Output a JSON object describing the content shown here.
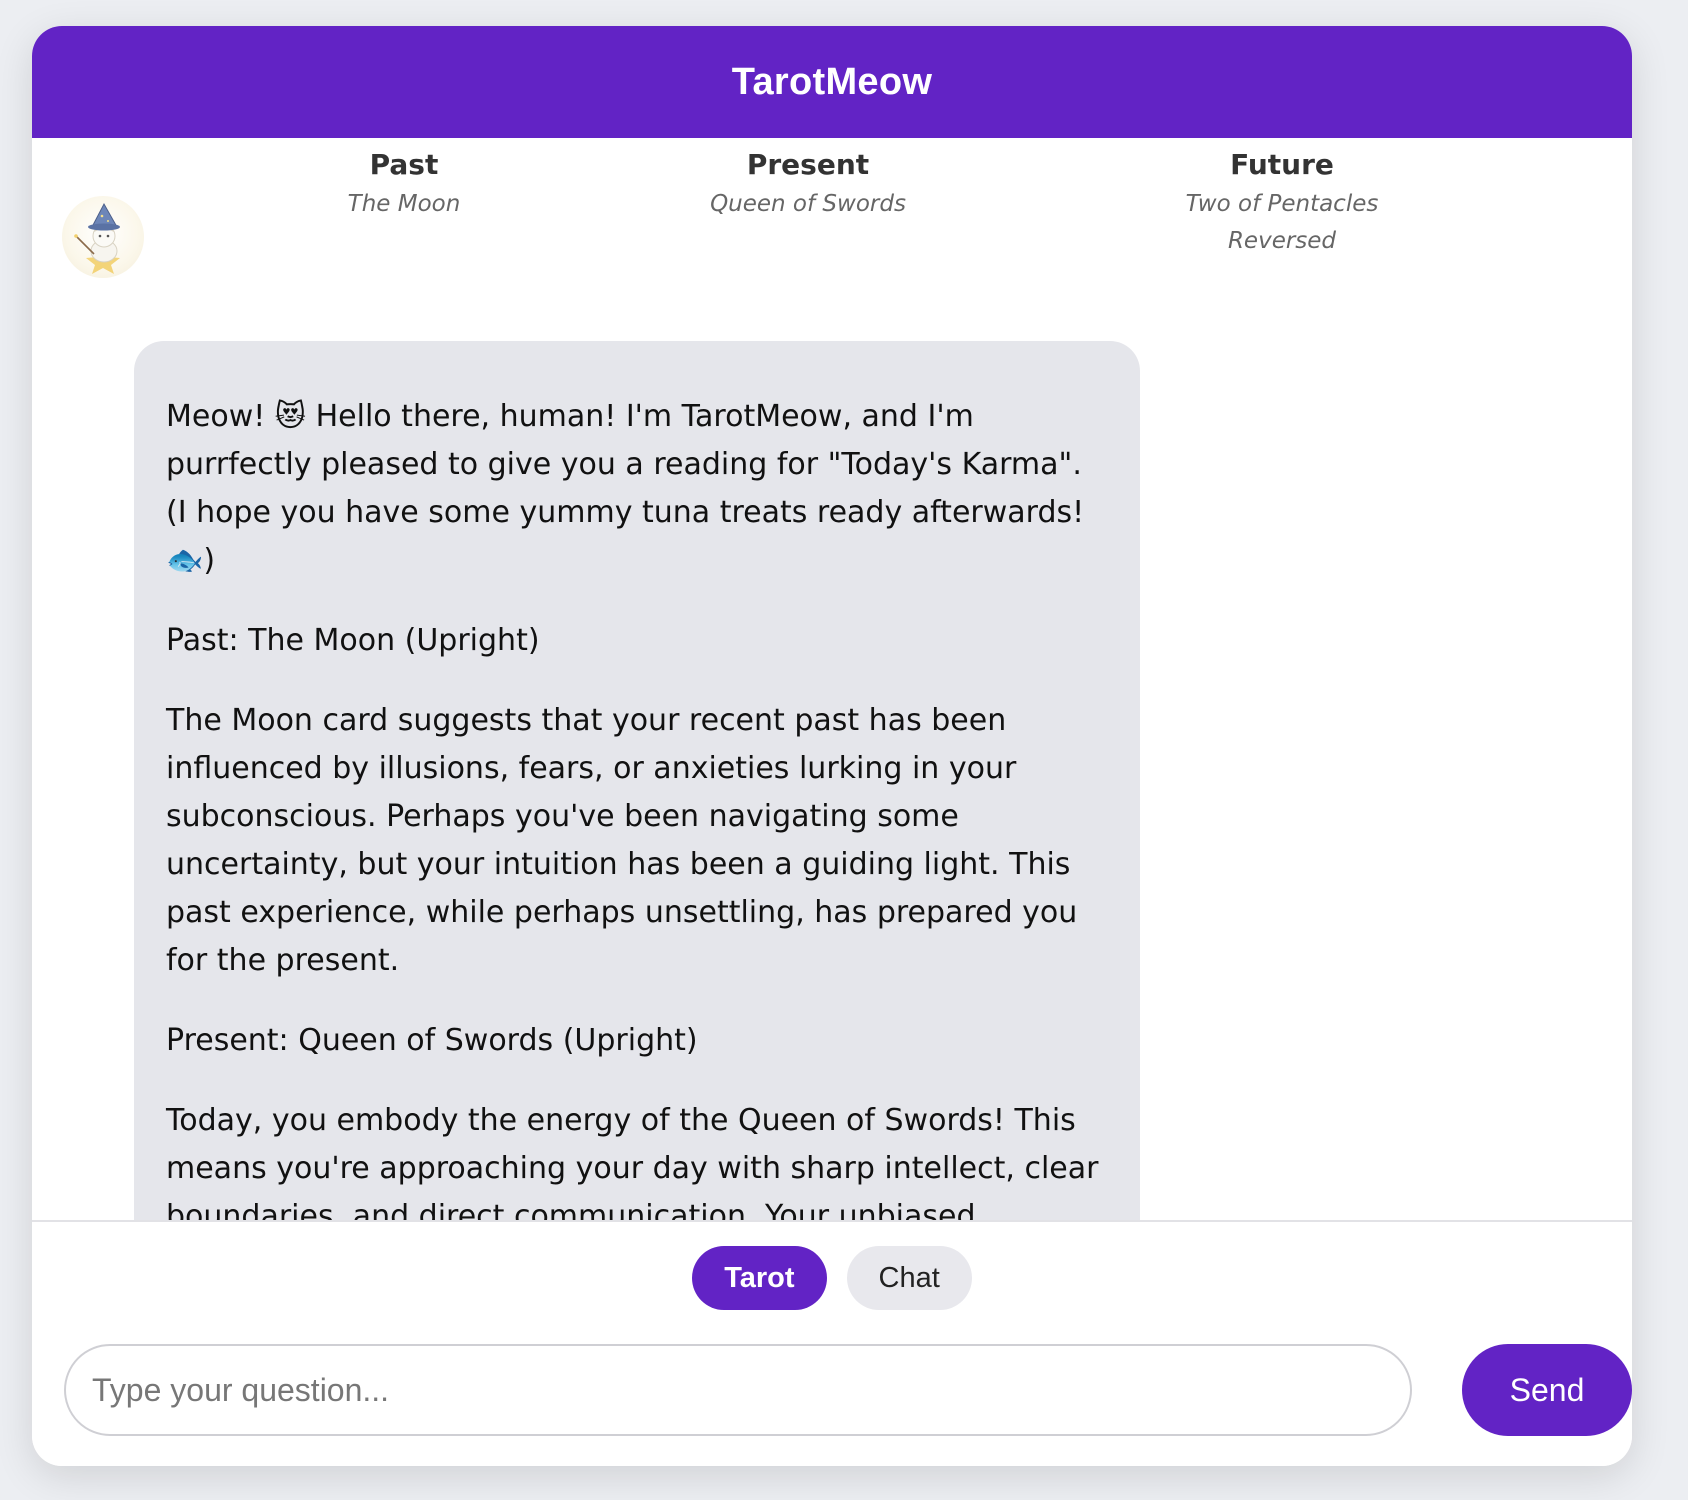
{
  "app": {
    "title": "TarotMeow"
  },
  "spread": [
    {
      "position": "Past",
      "card": "The Moon"
    },
    {
      "position": "Present",
      "card": "Queen of Swords"
    },
    {
      "position": "Future",
      "card": "Two of Pentacles Reversed"
    }
  ],
  "message": {
    "paragraphs": [
      "Meow! 😻 Hello there, human! I'm TarotMeow, and I'm purrfectly pleased to give you a reading for \"Today's Karma\". (I hope you have some yummy tuna treats ready afterwards! 🐟)",
      "Past: The Moon (Upright)",
      "The Moon card suggests that your recent past has been influenced by illusions, fears, or anxieties lurking in your subconscious. Perhaps you've been navigating some uncertainty, but your intuition has been a guiding light. This past experience, while perhaps unsettling, has prepared you for the present.",
      "Present: Queen of Swords (Upright)",
      "Today, you embody the energy of the Queen of Swords! This means you're approaching your day with sharp intellect, clear boundaries, and direct communication. Your unbiased judgment will serve you well. This is karmic payback for trusting your intuition; you're now reaping the rewards of clarity and"
    ]
  },
  "modes": {
    "tarot": "Tarot",
    "chat": "Chat",
    "active": "tarot"
  },
  "input": {
    "placeholder": "Type your question...",
    "value": ""
  },
  "send_label": "Send",
  "colors": {
    "accent": "#6223c5",
    "bubble": "#e5e6eb",
    "background": "#eceef2"
  },
  "icons": {
    "avatar": "wizard-cat-avatar-icon"
  }
}
